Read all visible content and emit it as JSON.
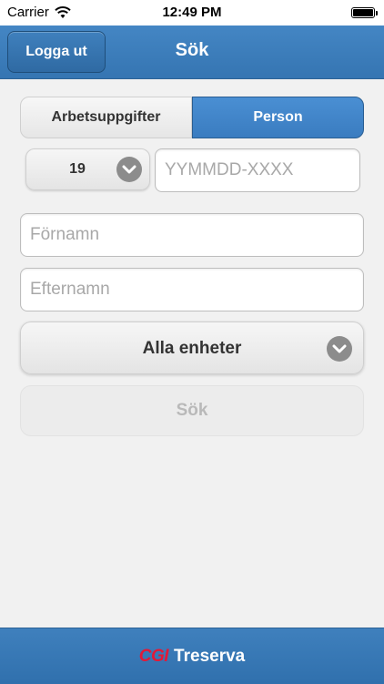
{
  "status_bar": {
    "carrier": "Carrier",
    "time": "12:49 PM"
  },
  "nav": {
    "logout_label": "Logga ut",
    "title": "Sök"
  },
  "segmented": {
    "options": [
      "Arbetsuppgifter",
      "Person"
    ],
    "selected": "Person"
  },
  "person_number": {
    "century_prefix": "19",
    "placeholder": "YYMMDD-XXXX",
    "value": ""
  },
  "first_name": {
    "placeholder": "Förnamn",
    "value": ""
  },
  "last_name": {
    "placeholder": "Efternamn",
    "value": ""
  },
  "units_select": {
    "selected": "Alla enheter"
  },
  "search_button": {
    "label": "Sök",
    "enabled": false
  },
  "footer": {
    "logo_text": "CGI",
    "brand": "Treserva"
  },
  "colors": {
    "nav_blue": "#3a7bb8",
    "selected_segment": "#4a8fd3",
    "logo_red": "#e31937",
    "background": "#f1f1f1"
  },
  "icons": [
    "wifi-icon",
    "battery-icon",
    "chevron-down-icon"
  ]
}
